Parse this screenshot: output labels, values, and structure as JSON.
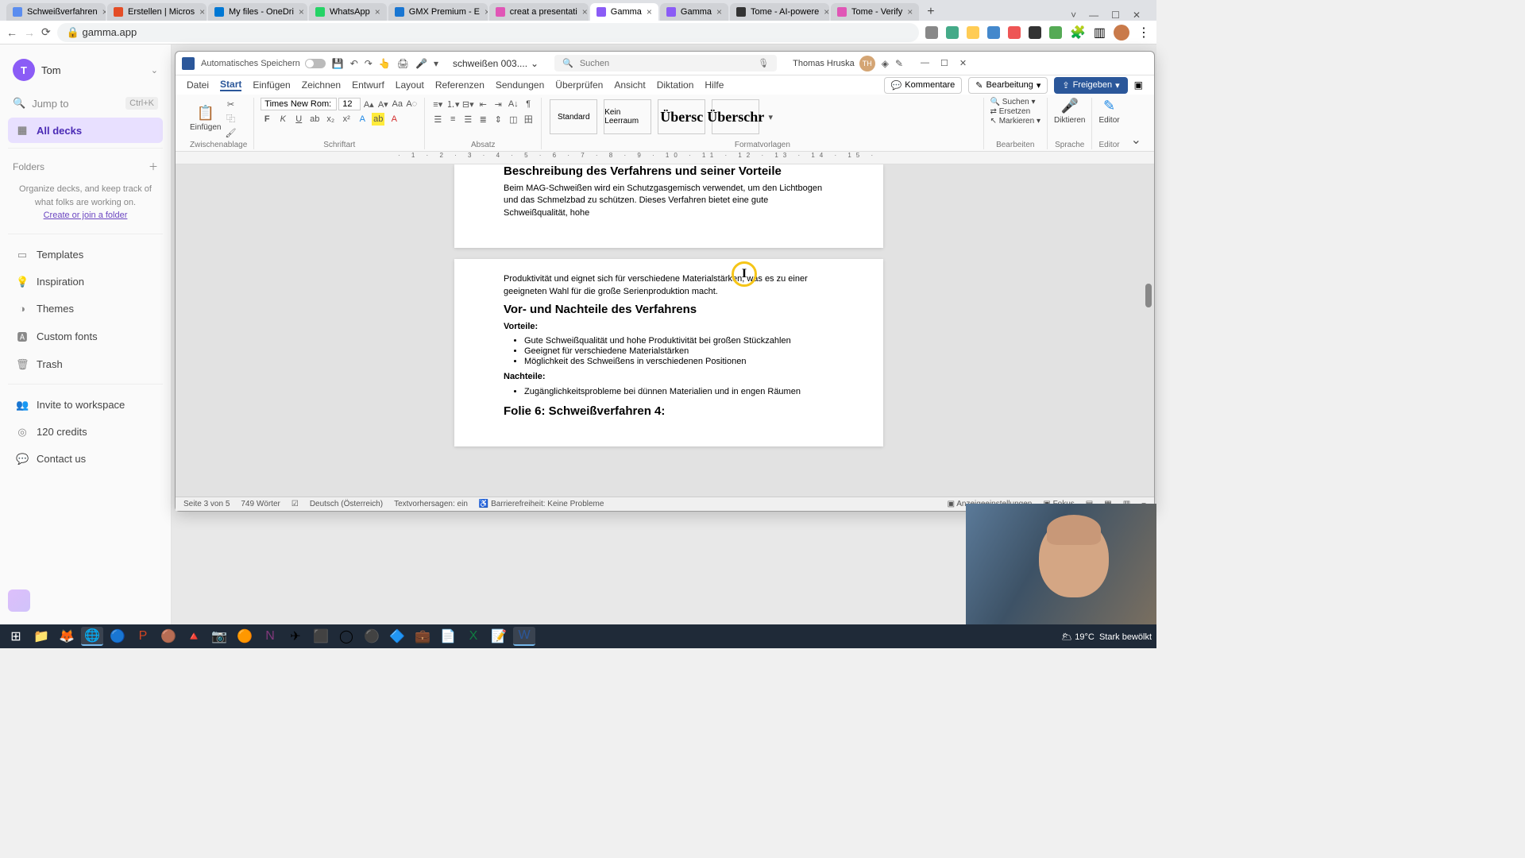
{
  "browser": {
    "tabs": [
      {
        "favicon": "#5b8def",
        "label": "Schweißverfahren"
      },
      {
        "favicon": "#e44d26",
        "label": "Erstellen | Micros"
      },
      {
        "favicon": "#0078d4",
        "label": "My files - OneDri"
      },
      {
        "favicon": "#25d366",
        "label": "WhatsApp"
      },
      {
        "favicon": "#1976d2",
        "label": "GMX Premium - E"
      },
      {
        "favicon": "#e056b6",
        "label": "creat a presentati"
      },
      {
        "favicon": "#8b5cf6",
        "label": "Gamma",
        "active": true
      },
      {
        "favicon": "#8b5cf6",
        "label": "Gamma"
      },
      {
        "favicon": "#333333",
        "label": "Tome - AI-powere"
      },
      {
        "favicon": "#e056b6",
        "label": "Tome - Verify"
      }
    ],
    "url": "gamma.app"
  },
  "gamma": {
    "user_initial": "T",
    "user_name": "Tom",
    "jump_label": "Jump to",
    "jump_kbd": "Ctrl+K",
    "all_decks": "All decks",
    "folders_title": "Folders",
    "folders_desc": "Organize decks, and keep track of what folks are working on.",
    "folders_link": "Create or join a folder",
    "nav": {
      "templates": "Templates",
      "inspiration": "Inspiration",
      "themes": "Themes",
      "custom_fonts": "Custom fonts",
      "trash": "Trash",
      "invite": "Invite to workspace",
      "credits": "120 credits",
      "contact": "Contact us"
    }
  },
  "word": {
    "autosave": "Automatisches Speichern",
    "doc_name": "schweißen 003....",
    "search_ph": "Suchen",
    "user_name": "Thomas Hruska",
    "user_initials": "TH",
    "tabs": {
      "datei": "Datei",
      "start": "Start",
      "einf": "Einfügen",
      "zeich": "Zeichnen",
      "entw": "Entwurf",
      "layout": "Layout",
      "ref": "Referenzen",
      "send": "Sendungen",
      "ueber": "Überprüfen",
      "ans": "Ansicht",
      "dikt": "Diktation",
      "hilfe": "Hilfe"
    },
    "actions": {
      "komm": "Kommentare",
      "bearb": "Bearbeitung",
      "frei": "Freigeben"
    },
    "ribbon": {
      "paste": "Einfügen",
      "g_clip": "Zwischenablage",
      "g_font": "Schriftart",
      "g_para": "Absatz",
      "g_styles": "Formatvorlagen",
      "g_edit": "Bearbeiten",
      "g_speech": "Sprache",
      "g_editor": "Editor",
      "font_name": "Times New Rom:",
      "font_size": "12",
      "style_std": "Standard",
      "style_nsp": "Kein Leerraum",
      "style_h1": "Übersc",
      "style_h2": "Überschr",
      "find": "Suchen",
      "replace": "Ersetzen",
      "select": "Markieren",
      "dictate": "Diktieren",
      "editor": "Editor"
    },
    "doc": {
      "h1": "Beschreibung des Verfahrens und seiner Vorteile",
      "p1": "Beim MAG-Schweißen wird ein Schutzgasgemisch verwendet, um den Lichtbogen und das Schmelzbad zu schützen. Dieses Verfahren bietet eine gute Schweißqualität, hohe",
      "p2": "Produktivität und eignet sich für verschiedene Materialstärken, was es zu einer geeigneten Wahl für die große Serienproduktion macht.",
      "h2": "Vor- und Nachteile des Verfahrens",
      "sub1": "Vorteile:",
      "adv": [
        "Gute Schweißqualität und hohe Produktivität bei großen Stückzahlen",
        "Geeignet für verschiedene Materialstärken",
        "Möglichkeit des Schweißens in verschiedenen Positionen"
      ],
      "sub2": "Nachteile:",
      "dis": [
        "Zugänglichkeitsprobleme bei dünnen Materialien und in engen Räumen"
      ],
      "h3": "Folie 6: Schweißverfahren 4:"
    },
    "status": {
      "page": "Seite 3 von 5",
      "words": "749 Wörter",
      "lang": "Deutsch (Österreich)",
      "pred": "Textvorhersagen: ein",
      "acc": "Barrierefreiheit: Keine Probleme",
      "disp": "Anzeigeeinstellungen",
      "focus": "Fokus"
    }
  },
  "taskbar": {
    "temp": "19°C",
    "weather": "Stark bewölkt"
  }
}
